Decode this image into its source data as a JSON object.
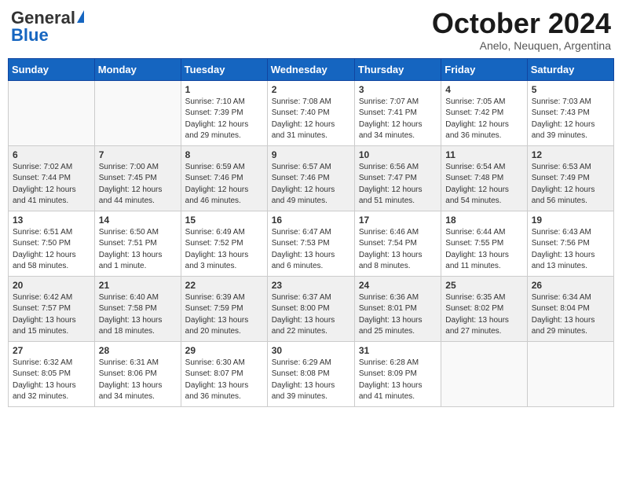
{
  "header": {
    "logo_general": "General",
    "logo_blue": "Blue",
    "month_title": "October 2024",
    "location": "Anelo, Neuquen, Argentina"
  },
  "days_of_week": [
    "Sunday",
    "Monday",
    "Tuesday",
    "Wednesday",
    "Thursday",
    "Friday",
    "Saturday"
  ],
  "weeks": [
    [
      {
        "day": "",
        "info": ""
      },
      {
        "day": "",
        "info": ""
      },
      {
        "day": "1",
        "info": "Sunrise: 7:10 AM\nSunset: 7:39 PM\nDaylight: 12 hours\nand 29 minutes."
      },
      {
        "day": "2",
        "info": "Sunrise: 7:08 AM\nSunset: 7:40 PM\nDaylight: 12 hours\nand 31 minutes."
      },
      {
        "day": "3",
        "info": "Sunrise: 7:07 AM\nSunset: 7:41 PM\nDaylight: 12 hours\nand 34 minutes."
      },
      {
        "day": "4",
        "info": "Sunrise: 7:05 AM\nSunset: 7:42 PM\nDaylight: 12 hours\nand 36 minutes."
      },
      {
        "day": "5",
        "info": "Sunrise: 7:03 AM\nSunset: 7:43 PM\nDaylight: 12 hours\nand 39 minutes."
      }
    ],
    [
      {
        "day": "6",
        "info": "Sunrise: 7:02 AM\nSunset: 7:44 PM\nDaylight: 12 hours\nand 41 minutes."
      },
      {
        "day": "7",
        "info": "Sunrise: 7:00 AM\nSunset: 7:45 PM\nDaylight: 12 hours\nand 44 minutes."
      },
      {
        "day": "8",
        "info": "Sunrise: 6:59 AM\nSunset: 7:46 PM\nDaylight: 12 hours\nand 46 minutes."
      },
      {
        "day": "9",
        "info": "Sunrise: 6:57 AM\nSunset: 7:46 PM\nDaylight: 12 hours\nand 49 minutes."
      },
      {
        "day": "10",
        "info": "Sunrise: 6:56 AM\nSunset: 7:47 PM\nDaylight: 12 hours\nand 51 minutes."
      },
      {
        "day": "11",
        "info": "Sunrise: 6:54 AM\nSunset: 7:48 PM\nDaylight: 12 hours\nand 54 minutes."
      },
      {
        "day": "12",
        "info": "Sunrise: 6:53 AM\nSunset: 7:49 PM\nDaylight: 12 hours\nand 56 minutes."
      }
    ],
    [
      {
        "day": "13",
        "info": "Sunrise: 6:51 AM\nSunset: 7:50 PM\nDaylight: 12 hours\nand 58 minutes."
      },
      {
        "day": "14",
        "info": "Sunrise: 6:50 AM\nSunset: 7:51 PM\nDaylight: 13 hours\nand 1 minute."
      },
      {
        "day": "15",
        "info": "Sunrise: 6:49 AM\nSunset: 7:52 PM\nDaylight: 13 hours\nand 3 minutes."
      },
      {
        "day": "16",
        "info": "Sunrise: 6:47 AM\nSunset: 7:53 PM\nDaylight: 13 hours\nand 6 minutes."
      },
      {
        "day": "17",
        "info": "Sunrise: 6:46 AM\nSunset: 7:54 PM\nDaylight: 13 hours\nand 8 minutes."
      },
      {
        "day": "18",
        "info": "Sunrise: 6:44 AM\nSunset: 7:55 PM\nDaylight: 13 hours\nand 11 minutes."
      },
      {
        "day": "19",
        "info": "Sunrise: 6:43 AM\nSunset: 7:56 PM\nDaylight: 13 hours\nand 13 minutes."
      }
    ],
    [
      {
        "day": "20",
        "info": "Sunrise: 6:42 AM\nSunset: 7:57 PM\nDaylight: 13 hours\nand 15 minutes."
      },
      {
        "day": "21",
        "info": "Sunrise: 6:40 AM\nSunset: 7:58 PM\nDaylight: 13 hours\nand 18 minutes."
      },
      {
        "day": "22",
        "info": "Sunrise: 6:39 AM\nSunset: 7:59 PM\nDaylight: 13 hours\nand 20 minutes."
      },
      {
        "day": "23",
        "info": "Sunrise: 6:37 AM\nSunset: 8:00 PM\nDaylight: 13 hours\nand 22 minutes."
      },
      {
        "day": "24",
        "info": "Sunrise: 6:36 AM\nSunset: 8:01 PM\nDaylight: 13 hours\nand 25 minutes."
      },
      {
        "day": "25",
        "info": "Sunrise: 6:35 AM\nSunset: 8:02 PM\nDaylight: 13 hours\nand 27 minutes."
      },
      {
        "day": "26",
        "info": "Sunrise: 6:34 AM\nSunset: 8:04 PM\nDaylight: 13 hours\nand 29 minutes."
      }
    ],
    [
      {
        "day": "27",
        "info": "Sunrise: 6:32 AM\nSunset: 8:05 PM\nDaylight: 13 hours\nand 32 minutes."
      },
      {
        "day": "28",
        "info": "Sunrise: 6:31 AM\nSunset: 8:06 PM\nDaylight: 13 hours\nand 34 minutes."
      },
      {
        "day": "29",
        "info": "Sunrise: 6:30 AM\nSunset: 8:07 PM\nDaylight: 13 hours\nand 36 minutes."
      },
      {
        "day": "30",
        "info": "Sunrise: 6:29 AM\nSunset: 8:08 PM\nDaylight: 13 hours\nand 39 minutes."
      },
      {
        "day": "31",
        "info": "Sunrise: 6:28 AM\nSunset: 8:09 PM\nDaylight: 13 hours\nand 41 minutes."
      },
      {
        "day": "",
        "info": ""
      },
      {
        "day": "",
        "info": ""
      }
    ]
  ]
}
